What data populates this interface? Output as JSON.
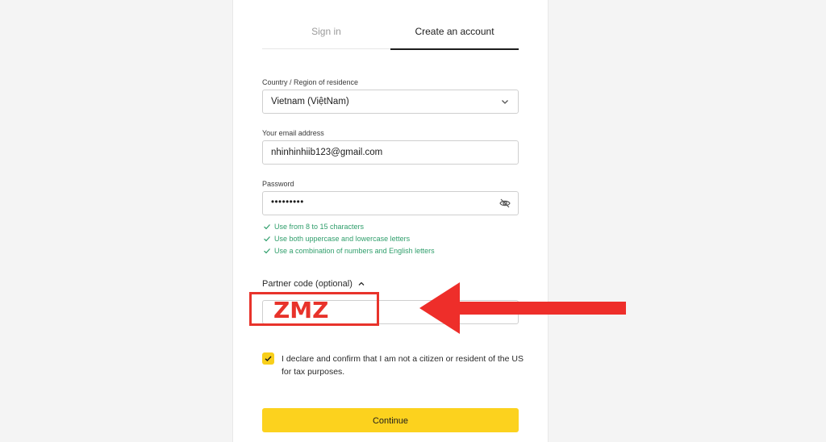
{
  "tabs": {
    "sign_in": "Sign in",
    "create_account": "Create an account"
  },
  "form": {
    "country": {
      "label": "Country / Region of residence",
      "value": "Vietnam (ViệtNam)"
    },
    "email": {
      "label": "Your email address",
      "value": "nhinhinhiib123@gmail.com"
    },
    "password": {
      "label": "Password",
      "value": "•••••••••",
      "rules": [
        "Use from 8 to 15 characters",
        "Use both uppercase and lowercase letters",
        "Use a combination of numbers and English letters"
      ]
    },
    "partner_code": {
      "label": "Partner code (optional)",
      "value": "ZMZ"
    },
    "declaration": {
      "text": "I declare and confirm that I am not a citizen or resident of the US for tax purposes.",
      "checked": true
    },
    "continue_label": "Continue"
  },
  "colors": {
    "accent": "#fcd21e",
    "rule_ok": "#2f9e6b",
    "annotation": "#e8332b"
  },
  "icons": {
    "country_dropdown": "chevron-down-icon",
    "password_toggle": "eye-off-icon",
    "partner_toggle": "chevron-up-icon",
    "rule_status": "check-icon"
  }
}
